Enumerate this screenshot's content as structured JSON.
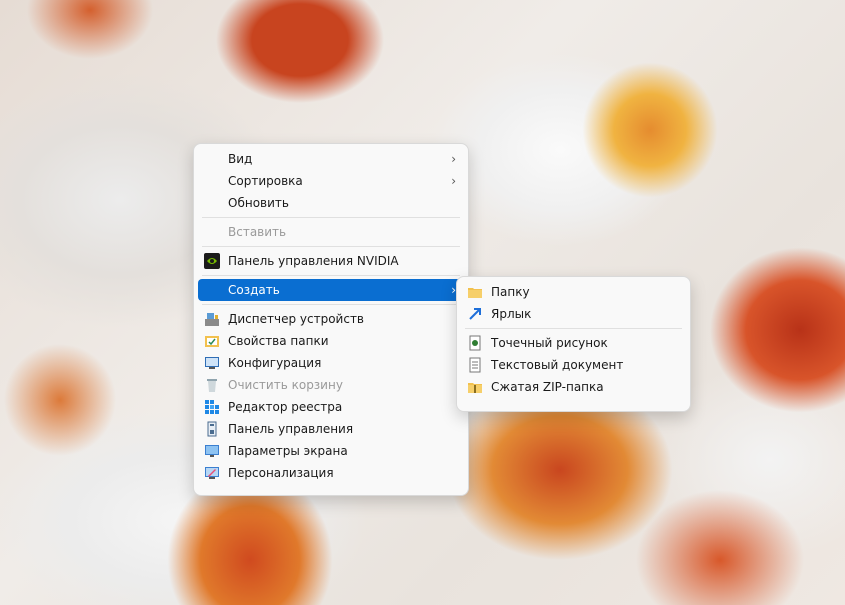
{
  "context_menu": {
    "view": "Вид",
    "sort": "Сортировка",
    "refresh": "Обновить",
    "paste": "Вставить",
    "nvidia": "Панель управления NVIDIA",
    "create": "Создать",
    "device_manager": "Диспетчер устройств",
    "folder_options": "Свойства папки",
    "configuration": "Конфигурация",
    "empty_recycle": "Очистить корзину",
    "registry_editor": "Редактор реестра",
    "control_panel": "Панель управления",
    "display_settings": "Параметры экрана",
    "personalization": "Персонализация"
  },
  "submenu": {
    "folder": "Папку",
    "shortcut": "Ярлык",
    "bitmap": "Точечный рисунок",
    "text_document": "Текстовый документ",
    "zip_folder": "Сжатая ZIP-папка"
  },
  "colors": {
    "highlight": "#0a6ed1",
    "menu_bg": "#f9f9f9",
    "disabled_text": "#9a9a9a"
  },
  "icons": {
    "submenu_arrow": "chevron-right-icon"
  }
}
